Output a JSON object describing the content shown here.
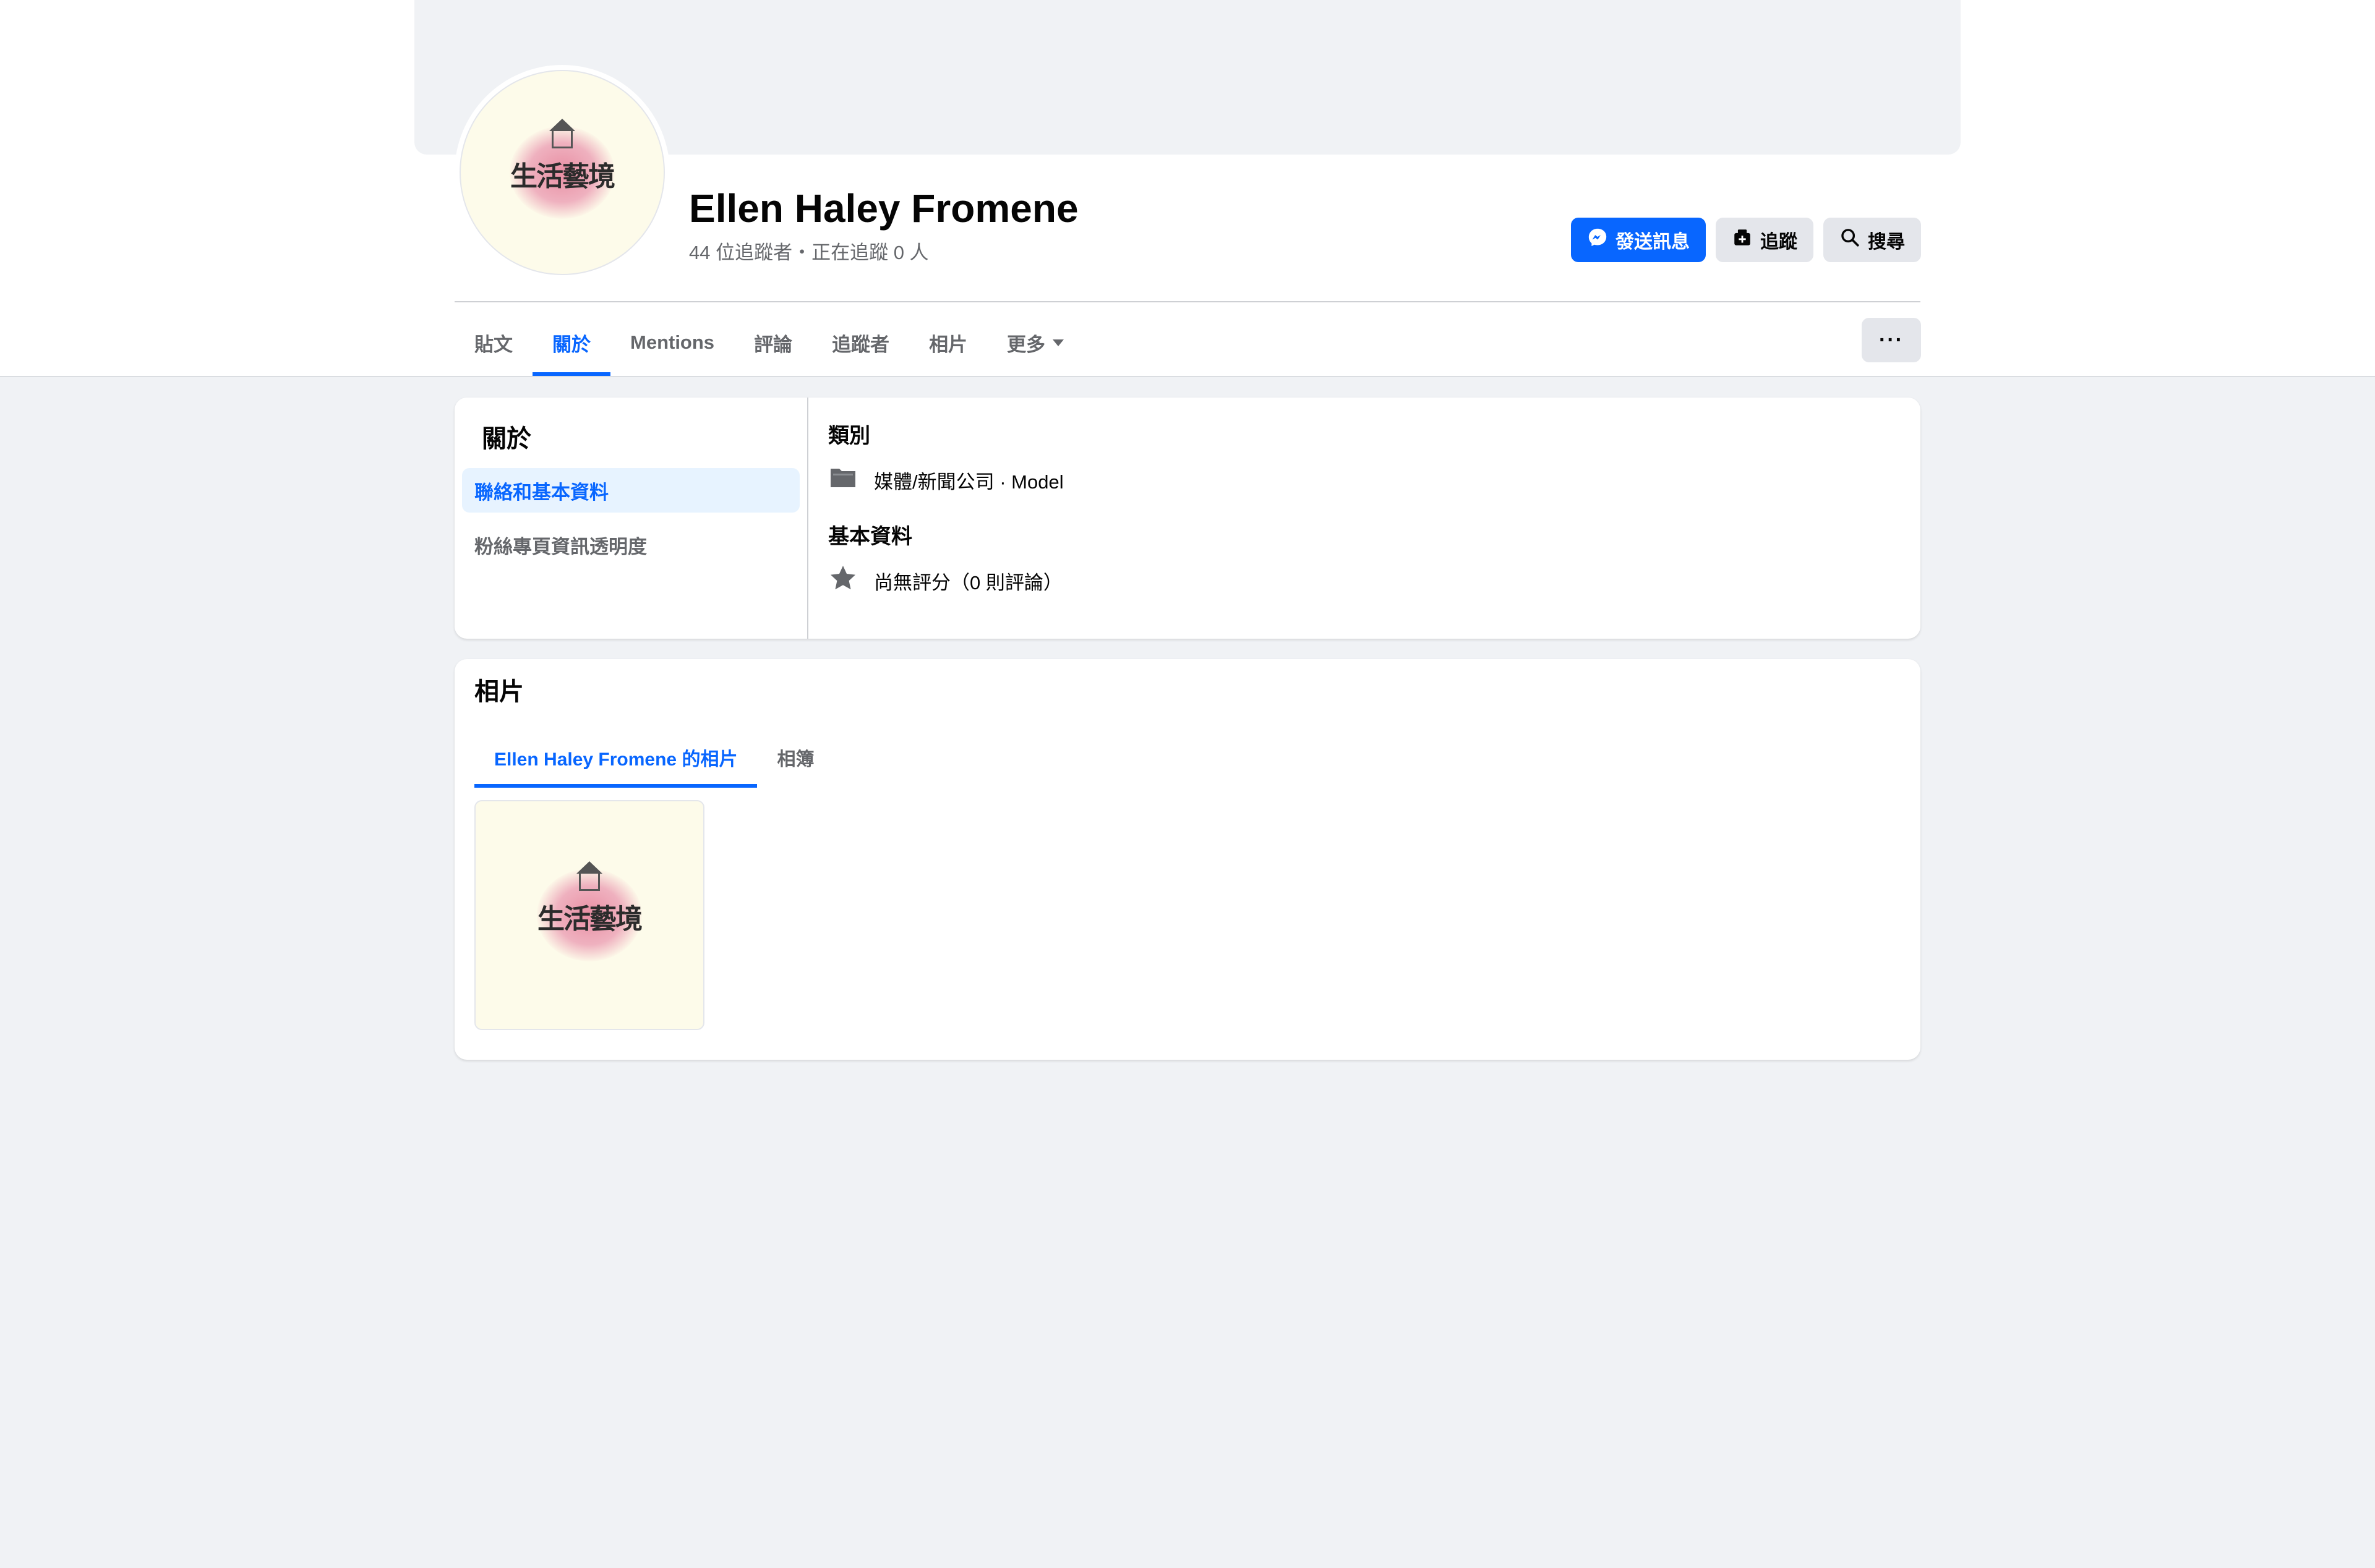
{
  "profile": {
    "name": "Ellen Haley Fromene",
    "meta": "44 位追蹤者・正在追蹤 0 人",
    "avatar_logo_text": "生活藝境"
  },
  "actions": {
    "message_label": "發送訊息",
    "follow_label": "追蹤",
    "search_label": "搜尋",
    "more_label": "···"
  },
  "tabs": [
    {
      "label": "貼文"
    },
    {
      "label": "關於"
    },
    {
      "label": "Mentions"
    },
    {
      "label": "評論"
    },
    {
      "label": "追蹤者"
    },
    {
      "label": "相片"
    },
    {
      "label": "更多"
    }
  ],
  "about": {
    "title": "關於",
    "nav": [
      {
        "label": "聯絡和基本資料"
      },
      {
        "label": "粉絲專頁資訊透明度"
      }
    ],
    "category_title": "類別",
    "category_value": "媒體/新聞公司 · Model",
    "basic_title": "基本資料",
    "rating_value": "尚無評分（0 則評論）"
  },
  "photos": {
    "title": "相片",
    "tabs": [
      {
        "label": "Ellen Haley Fromene 的相片"
      },
      {
        "label": "相簿"
      }
    ],
    "thumb_logo_text": "生活藝境"
  },
  "colors": {
    "accent": "#0866ff",
    "background": "#f0f2f5",
    "secondary_text": "#65676b"
  }
}
